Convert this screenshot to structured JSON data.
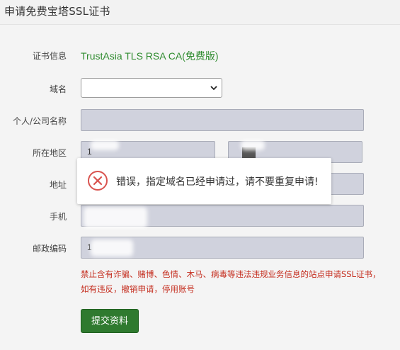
{
  "window": {
    "title": "申请免费宝塔SSL证书"
  },
  "form": {
    "cert_info": {
      "label": "证书信息",
      "value": "TrustAsia TLS RSA CA(免费版)"
    },
    "domain": {
      "label": "域名",
      "value": ""
    },
    "name": {
      "label": "个人/公司名称",
      "value": ""
    },
    "region": {
      "label": "所在地区",
      "province_value": "1",
      "city_value": ""
    },
    "address": {
      "label": "地址",
      "value": ""
    },
    "phone": {
      "label": "手机",
      "value": ""
    },
    "postcode": {
      "label": "邮政编码",
      "value": "1"
    },
    "warning": [
      "禁止含有诈骗、赌博、色情、木马、病毒等违法违规业务信息的站点申请SSL证书，",
      "如有违反，撤销申请，停用账号"
    ],
    "submit_label": "提交资料"
  },
  "toast": {
    "message": "错误，指定域名已经申请过，请不要重复申请!",
    "icon": "error-circle-x-icon",
    "color": "#d9534f"
  },
  "colors": {
    "accent_green": "#2e8b2e",
    "button_green": "#2f7a2f",
    "warning_red": "#c42b1c"
  }
}
